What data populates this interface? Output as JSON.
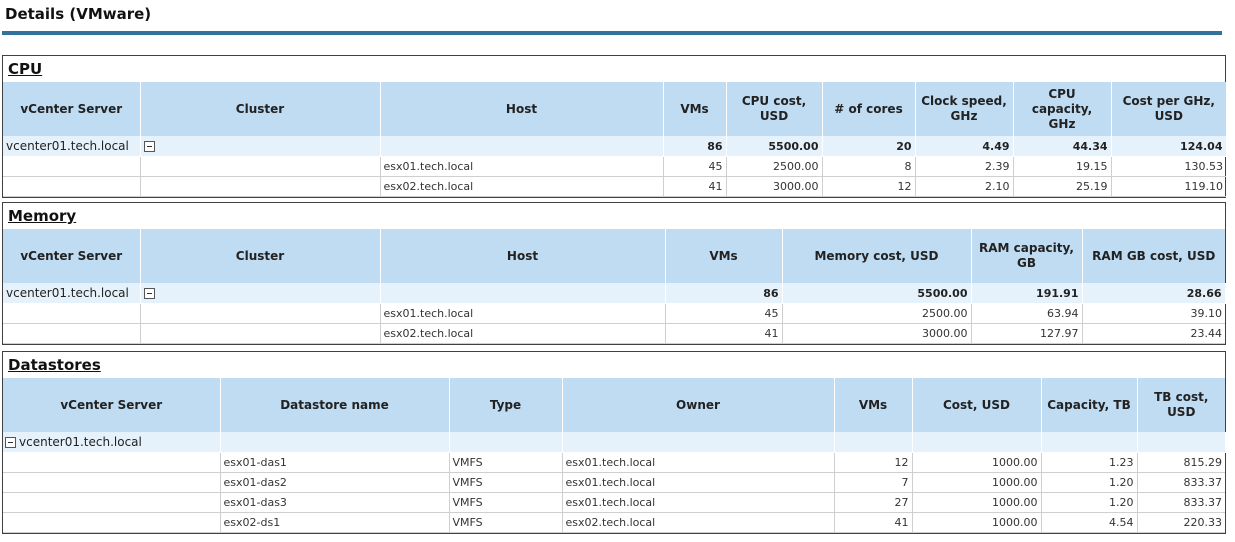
{
  "page_title": "Details (VMware)",
  "cpu": {
    "title": "CPU",
    "headers": [
      "vCenter Server",
      "Cluster",
      "Host",
      "VMs",
      "CPU cost, USD",
      "# of cores",
      "Clock speed, GHz",
      "CPU capacity, GHz",
      "Cost per GHz, USD"
    ],
    "summary": {
      "vcenter": "vcenter01.tech.local",
      "vms": "86",
      "cost": "5500.00",
      "cores": "20",
      "clock": "4.49",
      "capacity": "44.34",
      "per_ghz": "124.04"
    },
    "rows": [
      {
        "host": "esx01.tech.local",
        "vms": "45",
        "cost": "2500.00",
        "cores": "8",
        "clock": "2.39",
        "capacity": "19.15",
        "per_ghz": "130.53"
      },
      {
        "host": "esx02.tech.local",
        "vms": "41",
        "cost": "3000.00",
        "cores": "12",
        "clock": "2.10",
        "capacity": "25.19",
        "per_ghz": "119.10"
      }
    ]
  },
  "memory": {
    "title": "Memory",
    "headers": [
      "vCenter Server",
      "Cluster",
      "Host",
      "VMs",
      "Memory cost, USD",
      "RAM capacity, GB",
      "RAM GB cost, USD"
    ],
    "summary": {
      "vcenter": "vcenter01.tech.local",
      "vms": "86",
      "cost": "5500.00",
      "capacity": "191.91",
      "gb_cost": "28.66"
    },
    "rows": [
      {
        "host": "esx01.tech.local",
        "vms": "45",
        "cost": "2500.00",
        "capacity": "63.94",
        "gb_cost": "39.10"
      },
      {
        "host": "esx02.tech.local",
        "vms": "41",
        "cost": "3000.00",
        "capacity": "127.97",
        "gb_cost": "23.44"
      }
    ]
  },
  "datastores": {
    "title": "Datastores",
    "headers": [
      "vCenter Server",
      "Datastore name",
      "Type",
      "Owner",
      "VMs",
      "Cost, USD",
      "Capacity, TB",
      "TB cost, USD"
    ],
    "summary": {
      "vcenter": "vcenter01.tech.local"
    },
    "rows": [
      {
        "name": "esx01-das1",
        "type": "VMFS",
        "owner": "esx01.tech.local",
        "vms": "12",
        "cost": "1000.00",
        "capacity": "1.23",
        "tb_cost": "815.29"
      },
      {
        "name": "esx01-das2",
        "type": "VMFS",
        "owner": "esx01.tech.local",
        "vms": "7",
        "cost": "1000.00",
        "capacity": "1.20",
        "tb_cost": "833.37"
      },
      {
        "name": "esx01-das3",
        "type": "VMFS",
        "owner": "esx01.tech.local",
        "vms": "27",
        "cost": "1000.00",
        "capacity": "1.20",
        "tb_cost": "833.37"
      },
      {
        "name": "esx02-ds1",
        "type": "VMFS",
        "owner": "esx02.tech.local",
        "vms": "41",
        "cost": "1000.00",
        "capacity": "4.54",
        "tb_cost": "220.33"
      }
    ]
  }
}
